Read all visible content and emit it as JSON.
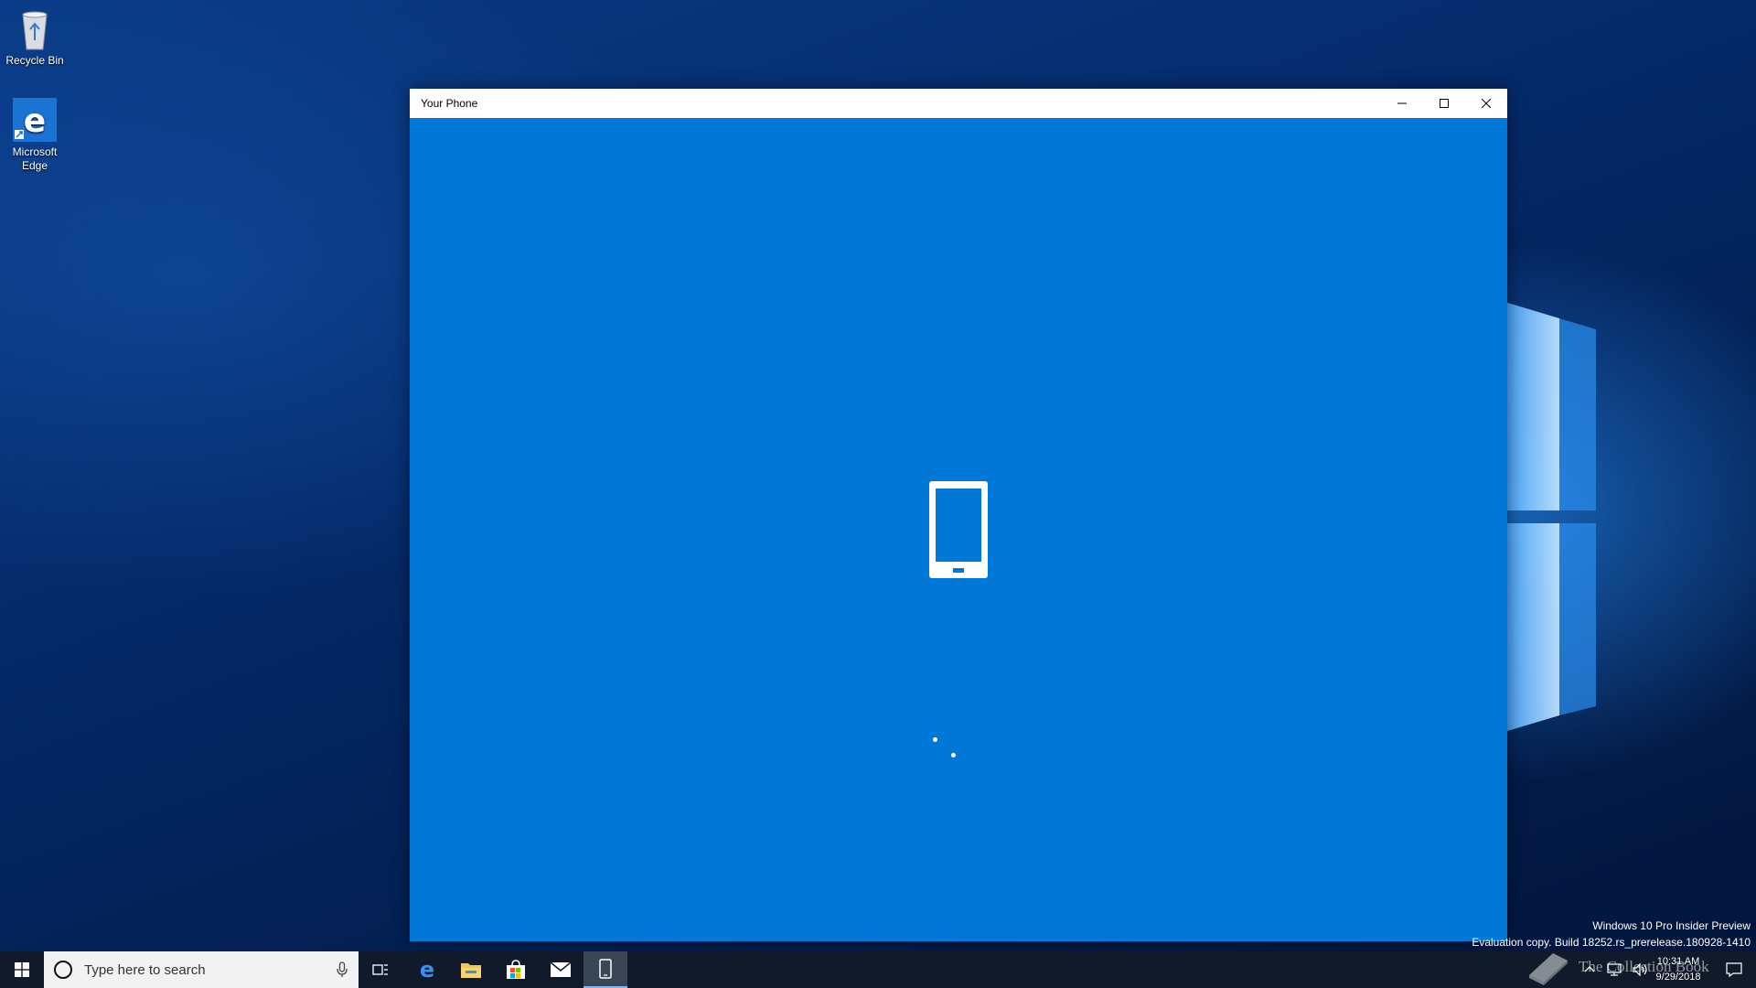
{
  "desktop": {
    "icons": [
      {
        "label": "Recycle Bin"
      },
      {
        "label": "Microsoft Edge"
      }
    ]
  },
  "window": {
    "title": "Your Phone",
    "background_color": "#0078d7",
    "controls": {
      "minimize_icon": "minimize-icon",
      "maximize_icon": "maximize-icon",
      "close_icon": "close-icon"
    },
    "center_icon": "phone-icon",
    "loading_indicator": "spinner"
  },
  "watermark": {
    "line1": "Windows 10 Pro Insider Preview",
    "line2": "Evaluation copy. Build 18252.rs_prerelease.180928-1410",
    "collection_text": "The Collection Book"
  },
  "taskbar": {
    "search": {
      "placeholder": "Type here to search"
    },
    "pinned": [
      "start-icon",
      "task-view-icon",
      "edge-icon",
      "file-explorer-icon",
      "store-icon",
      "mail-icon",
      "your-phone-icon"
    ],
    "active_app": "your-phone-icon",
    "clock": {
      "time": "10:31 AM",
      "date": "9/29/2018"
    }
  }
}
